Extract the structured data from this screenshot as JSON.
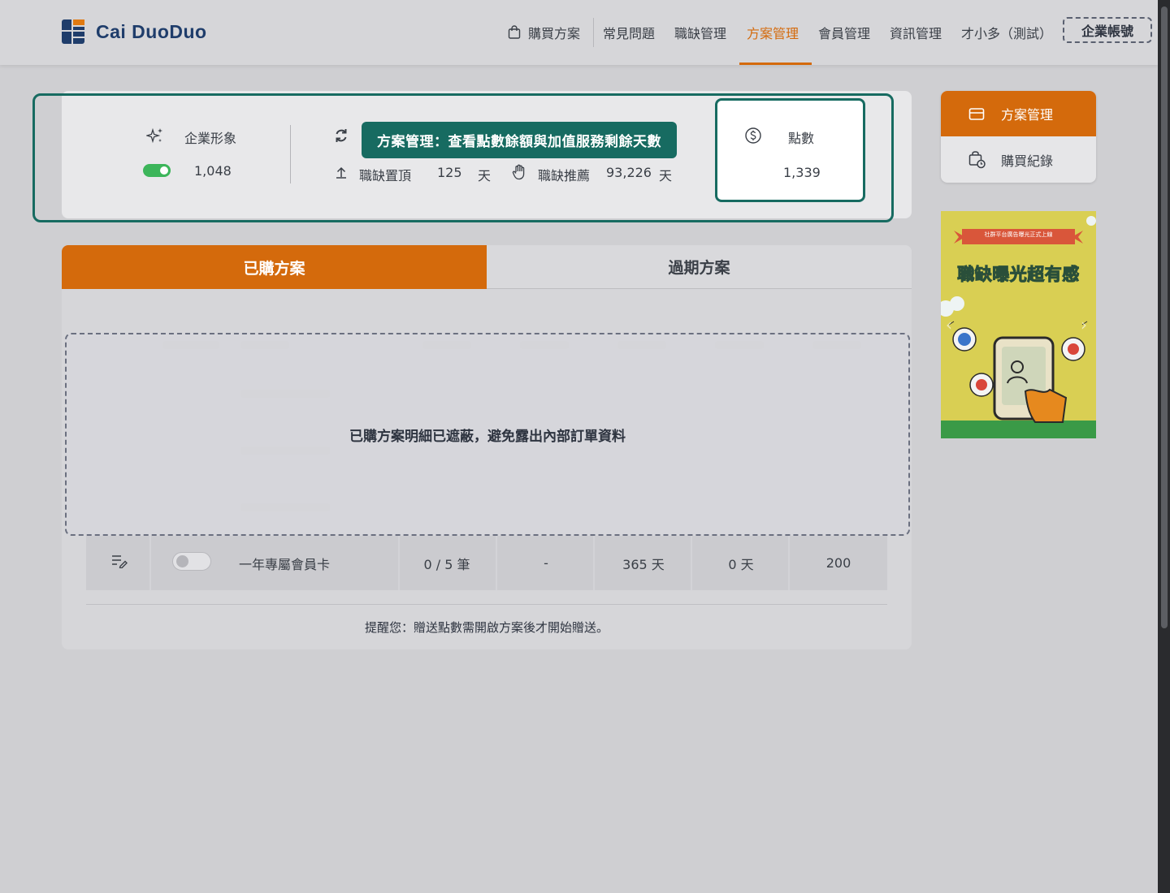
{
  "brand": {
    "name": "Cai DuoDuo"
  },
  "nav": {
    "buy_plan": "購買方案",
    "faq": "常見問題",
    "jobs": "職缺管理",
    "plans": "方案管理",
    "members": "會員管理",
    "info": "資訊管理",
    "user": "才小多（測試）",
    "corp_account": "企業帳號",
    "active_item": "方案管理"
  },
  "stats": {
    "corporate_image": {
      "label": "企業形象",
      "value": "1,048",
      "enabled": true
    },
    "job_pin": {
      "label": "職缺置頂",
      "value": "125",
      "unit": "天"
    },
    "job_recommend": {
      "label": "職缺推薦",
      "value": "93,226",
      "unit": "天"
    },
    "points": {
      "label": "點數",
      "value": "1,339"
    }
  },
  "tooltip": {
    "text": "方案管理：查看點數餘額與加值服務剩餘天數"
  },
  "side_menu": {
    "items": [
      {
        "label": "方案管理",
        "icon": "wallet-icon",
        "active": true
      },
      {
        "label": "購買紀錄",
        "icon": "bag-clock-icon",
        "active": false
      }
    ]
  },
  "ad": {
    "headline": "職缺曝光超有感",
    "ribbon": "社群平台廣告曝光正式上線"
  },
  "tabs": {
    "purchased": "已購方案",
    "expired": "過期方案",
    "active": "已購方案"
  },
  "mask": {
    "text": "已購方案明細已遮蔽，避免露出內部訂單資料"
  },
  "plan_row": {
    "name": "一年專屬會員卡",
    "usage": "0 / 5 筆",
    "dash": "-",
    "duration": "365 天",
    "remaining": "0 天",
    "points": "200",
    "enabled": false
  },
  "reminder": "提醒您：贈送點數需開啟方案後才開始贈送。",
  "colors": {
    "accent": "#d46a0c",
    "teal": "#176b61",
    "brand_navy": "#1f3d6b",
    "toggle_on": "#3cb55a"
  }
}
